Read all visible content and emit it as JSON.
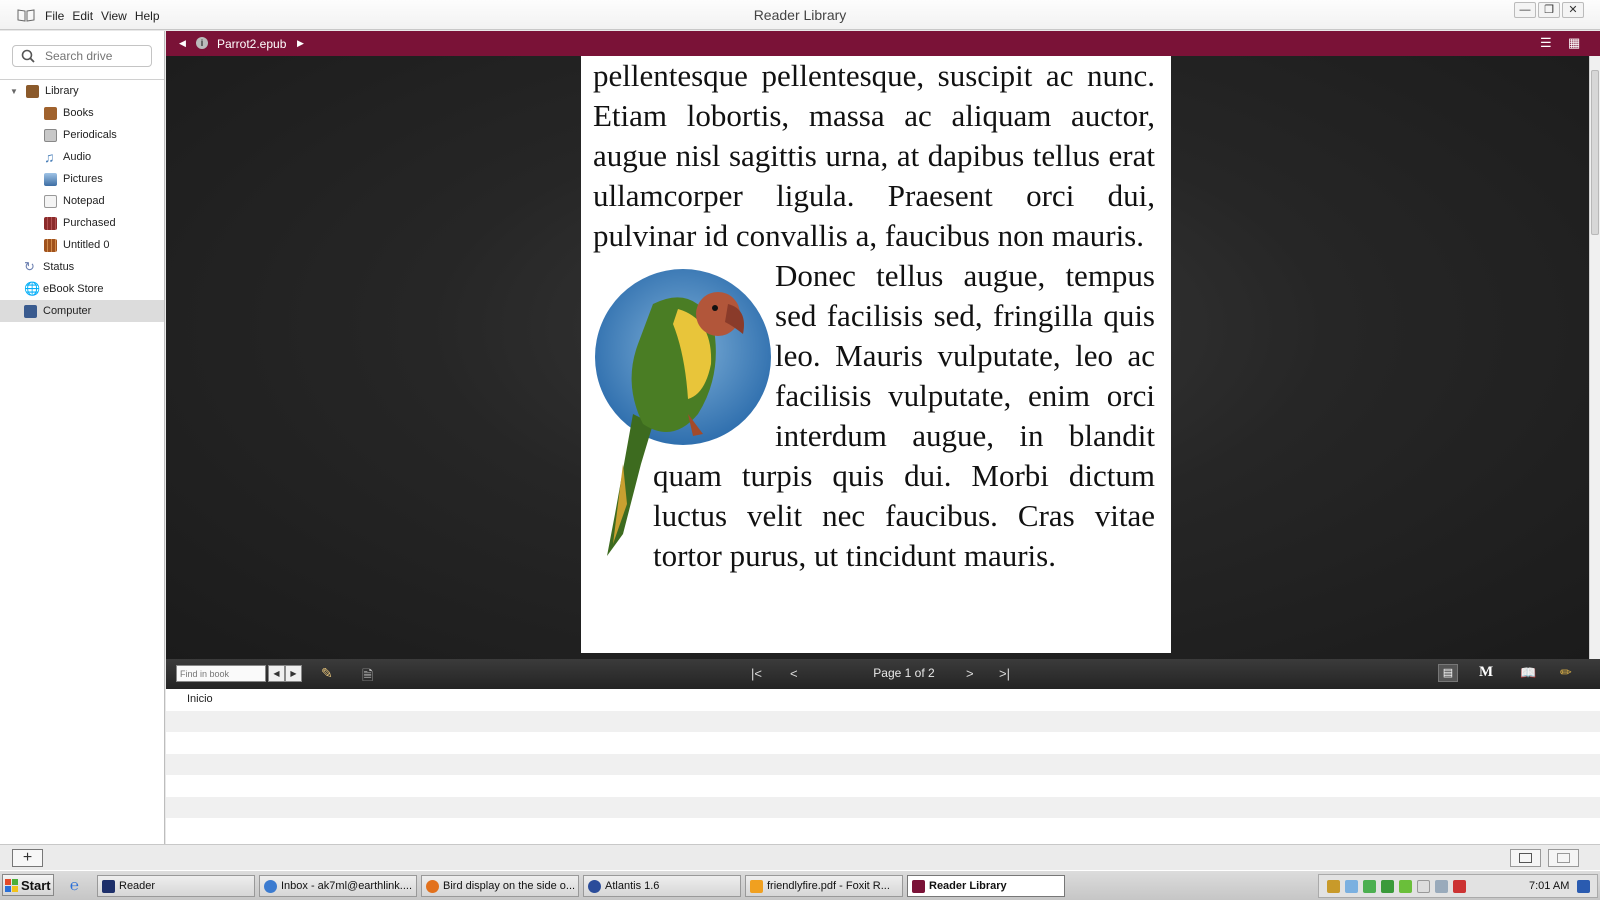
{
  "window": {
    "title": "Reader Library",
    "menus": [
      "File",
      "Edit",
      "View",
      "Help"
    ],
    "controls": [
      "minimize",
      "restore",
      "close"
    ]
  },
  "sidebar": {
    "search_placeholder": "Search drive",
    "items": [
      {
        "label": "Library",
        "icon": "library-icon",
        "color": "#8b5a2b",
        "level": 0,
        "expanded": true
      },
      {
        "label": "Books",
        "icon": "books-icon",
        "color": "#a0622d",
        "level": 1
      },
      {
        "label": "Periodicals",
        "icon": "periodicals-icon",
        "color": "#8a8a8a",
        "level": 1
      },
      {
        "label": "Audio",
        "icon": "audio-icon",
        "color": "#4a7fb8",
        "level": 1
      },
      {
        "label": "Pictures",
        "icon": "pictures-icon",
        "color": "#3c6da3",
        "level": 1
      },
      {
        "label": "Notepad",
        "icon": "notepad-icon",
        "color": "#9a9a9a",
        "level": 1
      },
      {
        "label": "Purchased",
        "icon": "purchased-icon",
        "color": "#8b2a2a",
        "level": 1
      },
      {
        "label": "Untitled 0",
        "icon": "collection-icon",
        "color": "#a0521d",
        "level": 1
      },
      {
        "label": "Status",
        "icon": "status-sync-icon",
        "color": "#6b7fb0",
        "level": 0
      },
      {
        "label": "eBook Store",
        "icon": "store-globe-icon",
        "color": "#b0303a",
        "level": 0
      },
      {
        "label": "Computer",
        "icon": "computer-icon",
        "color": "#3a5b8f",
        "level": 0,
        "selected": true
      }
    ]
  },
  "reader": {
    "file_name": "Parrot2.epub",
    "accent_color": "#7a1237",
    "paragraphs": [
      "pellentesque pellentesque, suscipit ac nunc. Etiam lobortis, massa ac aliquam auctor, augue nisl sagittis urna, at dapibus tellus erat ullamcorper ligula. Praesent orci dui, pulvinar id convallis a, faucibus non mauris.",
      "Donec tellus augue, tempus sed facilisis sed, fringilla quis leo. Mauris vulputate, leo ac facilisis vulputate, enim orci interdum augue, in blandit quam turpis quis dui. Morbi dictum luctus velit nec faucibus. Cras vitae tortor purus, ut tincidunt mauris."
    ],
    "image": "parrot-illustration"
  },
  "bottom_toolbar": {
    "find_placeholder": "Find in book",
    "page_label": "Page 1 of 2"
  },
  "toc": {
    "items": [
      "Inicio"
    ]
  },
  "taskbar": {
    "start_label": "Start",
    "tasks": [
      {
        "label": "Reader",
        "icon": "reader-app-icon"
      },
      {
        "label": "Inbox - ak7ml@earthlink....",
        "icon": "email-icon"
      },
      {
        "label": "Bird display on the side o...",
        "icon": "firefox-icon"
      },
      {
        "label": "Atlantis 1.6",
        "icon": "atlantis-icon"
      },
      {
        "label": "friendlyfire.pdf - Foxit R...",
        "icon": "pdf-icon"
      },
      {
        "label": "Reader Library",
        "icon": "reader-library-icon",
        "active": true
      }
    ],
    "clock": "7:01 AM"
  }
}
